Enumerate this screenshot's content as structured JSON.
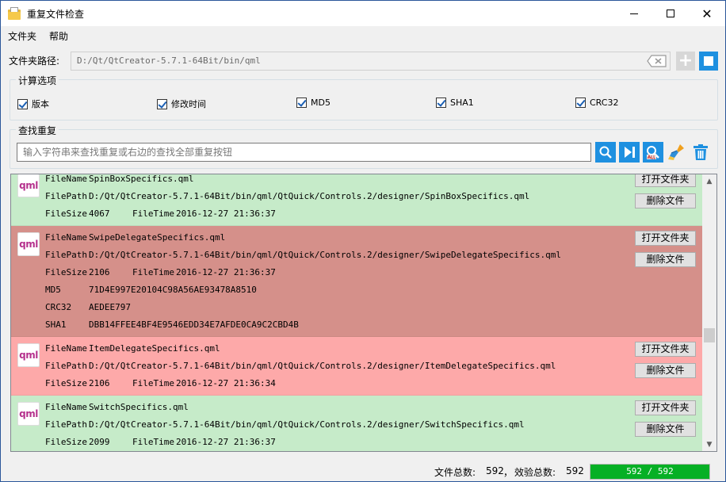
{
  "window": {
    "title": "重复文件检查"
  },
  "menu": {
    "items": [
      "文件夹",
      "帮助"
    ]
  },
  "path": {
    "label": "文件夹路径:",
    "value": "D:/Qt/QtCreator-5.7.1-64Bit/bin/qml"
  },
  "options": {
    "title": "计算选项",
    "items": [
      {
        "label": "版本",
        "checked": true
      },
      {
        "label": "修改时间",
        "checked": true
      },
      {
        "label": "MD5",
        "checked": true
      },
      {
        "label": "SHA1",
        "checked": true
      },
      {
        "label": "CRC32",
        "checked": true
      }
    ]
  },
  "search": {
    "title": "查找重复",
    "placeholder": "输入字符串来查找重复或右边的查找全部重复按钮"
  },
  "colors": {
    "accent": "#1e90e0",
    "row_green": "#c6ebc9",
    "row_darkred": "#d5908a",
    "row_pink": "#fda9a9",
    "progress": "#06b025"
  },
  "results": {
    "icon_text": "qml",
    "open_label": "打开文件夹",
    "delete_label": "删除文件",
    "rows": [
      {
        "style": "green",
        "lines": [
          [
            "FileName",
            "SpinBoxSpecifics.qml"
          ],
          [
            "FilePath",
            "D:/Qt/QtCreator-5.7.1-64Bit/bin/qml/QtQuick/Controls.2/designer/SpinBoxSpecifics.qml"
          ],
          [
            "FileSize",
            "4067",
            "FileTime",
            "2016-12-27 21:36:37"
          ]
        ]
      },
      {
        "style": "darkred",
        "lines": [
          [
            "FileName",
            "SwipeDelegateSpecifics.qml"
          ],
          [
            "FilePath",
            "D:/Qt/QtCreator-5.7.1-64Bit/bin/qml/QtQuick/Controls.2/designer/SwipeDelegateSpecifics.qml"
          ],
          [
            "FileSize",
            "2106",
            "FileTime",
            "2016-12-27 21:36:37"
          ],
          [
            "MD5",
            "71D4E997E20104C98A56AE93478A8510"
          ],
          [
            "CRC32",
            "AEDEE797"
          ],
          [
            "SHA1",
            "DBB14FFEE4BF4E9546EDD34E7AFDE0CA9C2CBD4B"
          ]
        ]
      },
      {
        "style": "pink",
        "lines": [
          [
            "FileName",
            "ItemDelegateSpecifics.qml"
          ],
          [
            "FilePath",
            "D:/Qt/QtCreator-5.7.1-64Bit/bin/qml/QtQuick/Controls.2/designer/ItemDelegateSpecifics.qml"
          ],
          [
            "FileSize",
            "2106",
            "FileTime",
            "2016-12-27 21:36:34"
          ]
        ]
      },
      {
        "style": "green",
        "lines": [
          [
            "FileName",
            "SwitchSpecifics.qml"
          ],
          [
            "FilePath",
            "D:/Qt/QtCreator-5.7.1-64Bit/bin/qml/QtQuick/Controls.2/designer/SwitchSpecifics.qml"
          ],
          [
            "FileSize",
            "2099",
            "FileTime",
            "2016-12-27 21:36:37"
          ]
        ]
      },
      {
        "style": "darkred",
        "lines": []
      }
    ]
  },
  "status": {
    "total_label": "文件总数:",
    "total_value": "592",
    "sep": "，",
    "checked_label": "效验总数:",
    "checked_value": "592",
    "progress_text": "592 / 592",
    "progress_fraction": 1.0
  }
}
